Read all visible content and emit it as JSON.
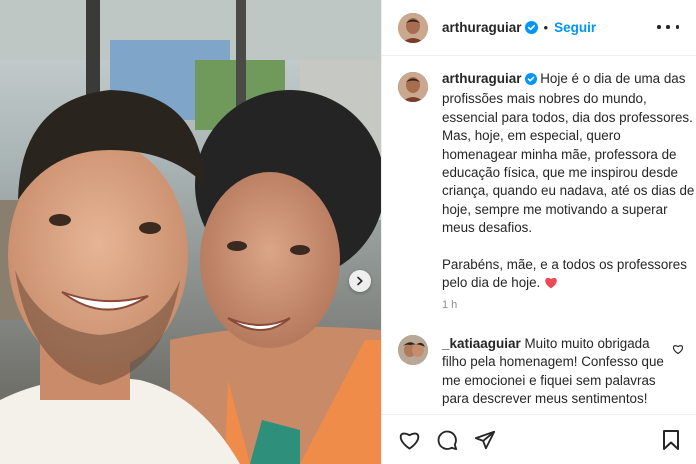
{
  "post": {
    "author": "arthuraguiar",
    "follow_label": "Seguir",
    "dot": "•",
    "caption_paragraph_1": "Hoje é o dia de uma das profissões mais nobres do mundo, essencial para todos, dia dos professores. Mas, hoje, em especial, quero homenagear minha mãe, professora de educação física, que me inspirou desde criança, quando eu nadava, até os dias de hoje, sempre me motivando a superar meus desafios.",
    "caption_paragraph_2": "Parabéns, mãe, e a todos os professores pelo dia de hoje.",
    "time_ago": "1 h"
  },
  "comment": {
    "author": "_katiaaguiar",
    "text": "Muito muito obrigada filho pela homenagem! Confesso que me emocionei e fiquei sem palavras para descrever meus sentimentos!"
  },
  "icons": {
    "more": "more-options-icon",
    "verified": "verified-badge-icon",
    "heart": "heart-icon",
    "comment": "comment-icon",
    "share": "share-icon",
    "save": "bookmark-icon",
    "carousel": "chevron-right-icon",
    "emoji": "red-heart-emoji"
  },
  "colors": {
    "accent": "#0095f6",
    "text": "#262626",
    "muted": "#8e8e8e",
    "emoji_heart": "#ed4956"
  }
}
